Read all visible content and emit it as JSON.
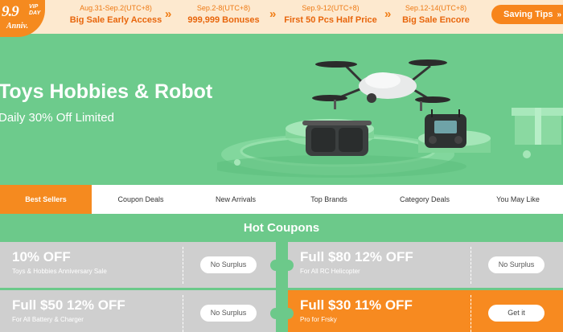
{
  "promo": {
    "badge": {
      "number": "9.9",
      "vip": "VIP",
      "day": "DAY",
      "anniv": "Anniv."
    },
    "phases": [
      {
        "date": "Aug.31-Sep.2(UTC+8)",
        "name": "Big Sale Early Access"
      },
      {
        "date": "Sep.2-8(UTC+8)",
        "name": "999,999 Bonuses"
      },
      {
        "date": "Sep.9-12(UTC+8)",
        "name": "First 50 Pcs Half Price"
      },
      {
        "date": "Sep.12-14(UTC+8)",
        "name": "Big Sale Encore"
      }
    ],
    "arrow_glyph": "»",
    "saving_tips": "Saving Tips",
    "saving_tips_chevron": "»"
  },
  "hero": {
    "title": "Toys Hobbies & Robot",
    "subtitle": "Daily 30% Off Limited"
  },
  "tabs": [
    {
      "label": "Best Sellers",
      "active": true
    },
    {
      "label": "Coupon Deals",
      "active": false
    },
    {
      "label": "New Arrivals",
      "active": false
    },
    {
      "label": "Top Brands",
      "active": false
    },
    {
      "label": "Category Deals",
      "active": false
    },
    {
      "label": "You May Like",
      "active": false
    }
  ],
  "coupons": {
    "heading": "Hot Coupons",
    "items": [
      {
        "title": "10% OFF",
        "subtitle": "Toys & Hobbies Anniversary Sale",
        "button": "No Surplus",
        "highlight": false
      },
      {
        "title": "Full $80 12% OFF",
        "subtitle": "For All RC Helicopter",
        "button": "No Surplus",
        "highlight": false
      },
      {
        "title": "Full $50 12% OFF",
        "subtitle": "For All Battery & Charger",
        "button": "No Surplus",
        "highlight": false
      },
      {
        "title": "Full $30 11% OFF",
        "subtitle": "Pro for Frsky",
        "button": "Get it",
        "highlight": true
      }
    ]
  },
  "colors": {
    "accent_orange": "#f58a1f",
    "hero_green": "#6dcb8c",
    "promo_bar_bg": "#fde9cf",
    "coupon_gray": "#cfcfcf"
  }
}
